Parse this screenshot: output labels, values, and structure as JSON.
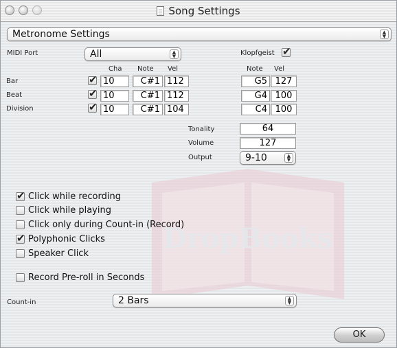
{
  "window": {
    "title": "Song Settings"
  },
  "section_popup": {
    "value": "Metronome Settings"
  },
  "midi_port": {
    "label": "MIDI Port",
    "value": "All"
  },
  "klopfgeist": {
    "label": "Klopfgeist",
    "checked": true
  },
  "left_headers": {
    "cha": "Cha",
    "note": "Note",
    "vel": "Vel"
  },
  "right_headers": {
    "note": "Note",
    "vel": "Vel"
  },
  "rows": [
    {
      "label": "Bar",
      "checked": true,
      "cha": "10",
      "note": "C#1",
      "vel": "112",
      "k_note": "G5",
      "k_vel": "127"
    },
    {
      "label": "Beat",
      "checked": true,
      "cha": "10",
      "note": "C#1",
      "vel": "112",
      "k_note": "G4",
      "k_vel": "100"
    },
    {
      "label": "Division",
      "checked": true,
      "cha": "10",
      "note": "C#1",
      "vel": "104",
      "k_note": "C4",
      "k_vel": "100"
    }
  ],
  "tonality": {
    "label": "Tonality",
    "value": "64"
  },
  "volume": {
    "label": "Volume",
    "value": "127"
  },
  "output": {
    "label": "Output",
    "value": "9-10"
  },
  "options": [
    {
      "label": "Click while recording",
      "checked": true
    },
    {
      "label": "Click while playing",
      "checked": false
    },
    {
      "label": "Click only during Count-in (Record)",
      "checked": false
    },
    {
      "label": "Polyphonic Clicks",
      "checked": true
    },
    {
      "label": "Speaker Click",
      "checked": false
    }
  ],
  "preroll": {
    "label": "Record Pre-roll in Seconds",
    "checked": false
  },
  "count_in": {
    "label": "Count-in",
    "value": "2 Bars"
  },
  "ok_button": {
    "label": "OK"
  },
  "watermark": {
    "text": "DropBooks"
  }
}
